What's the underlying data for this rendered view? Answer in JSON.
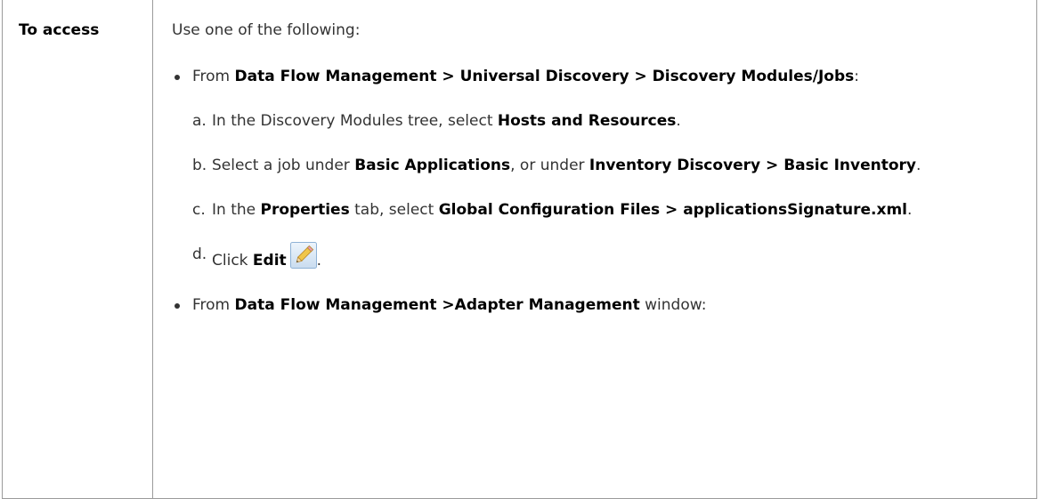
{
  "access": {
    "label": "To access",
    "intro": "Use one of the following:",
    "bullets": [
      {
        "t1": "From ",
        "b1": "Data Flow Management > Universal Discovery > Discovery Modules/Jobs",
        "t2": ":"
      },
      {
        "t1": "From ",
        "b1": "Data Flow Management >Adapter Management",
        "t2": " window:"
      }
    ],
    "steps": [
      {
        "marker": "a.",
        "t1": "In the Discovery Modules tree, select ",
        "b1": "Hosts and Resources",
        "t2": "."
      },
      {
        "marker": "b.",
        "t1": "Select a job under ",
        "b1": "Basic Applications",
        "t2": ", or under ",
        "b2": "Inventory Discovery > Basic Inventory",
        "t3": "."
      },
      {
        "marker": "c.",
        "t1": "In the ",
        "b1": "Properties",
        "t2": " tab, select ",
        "b2": "Global Configuration Files > applicationsSignature.xml",
        "t3": "."
      },
      {
        "marker": "d.",
        "t1": "Click ",
        "b1": "Edit",
        "t2": "."
      }
    ],
    "edit_icon": "pencil-edit-icon"
  }
}
